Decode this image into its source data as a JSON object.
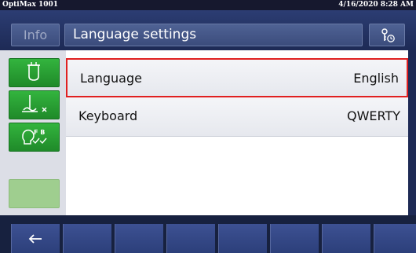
{
  "status_bar": {
    "device_name": "OptiMax 1001",
    "datetime": "4/16/2020 8:28 AM"
  },
  "header": {
    "info_label": "Info",
    "title": "Language settings",
    "settings_icon": "settings-clock-icon"
  },
  "sidebar": {
    "buttons": [
      {
        "icon": "reactor-icon",
        "state": "active"
      },
      {
        "icon": "stirrer-off-icon",
        "state": "active"
      },
      {
        "icon": "feedback-fb-icon",
        "state": "active"
      },
      {
        "icon": "",
        "state": "disabled"
      }
    ]
  },
  "settings_list": [
    {
      "label": "Language",
      "value": "English",
      "selected": true
    },
    {
      "label": "Keyboard",
      "value": "QWERTY",
      "selected": false
    }
  ],
  "bottom_bar": {
    "back_icon": "back-arrow-icon",
    "empty_slots": 7
  },
  "colors": {
    "header_bg": "#2c3d73",
    "accent_green": "#33b43e",
    "selection_border": "#e02020"
  }
}
